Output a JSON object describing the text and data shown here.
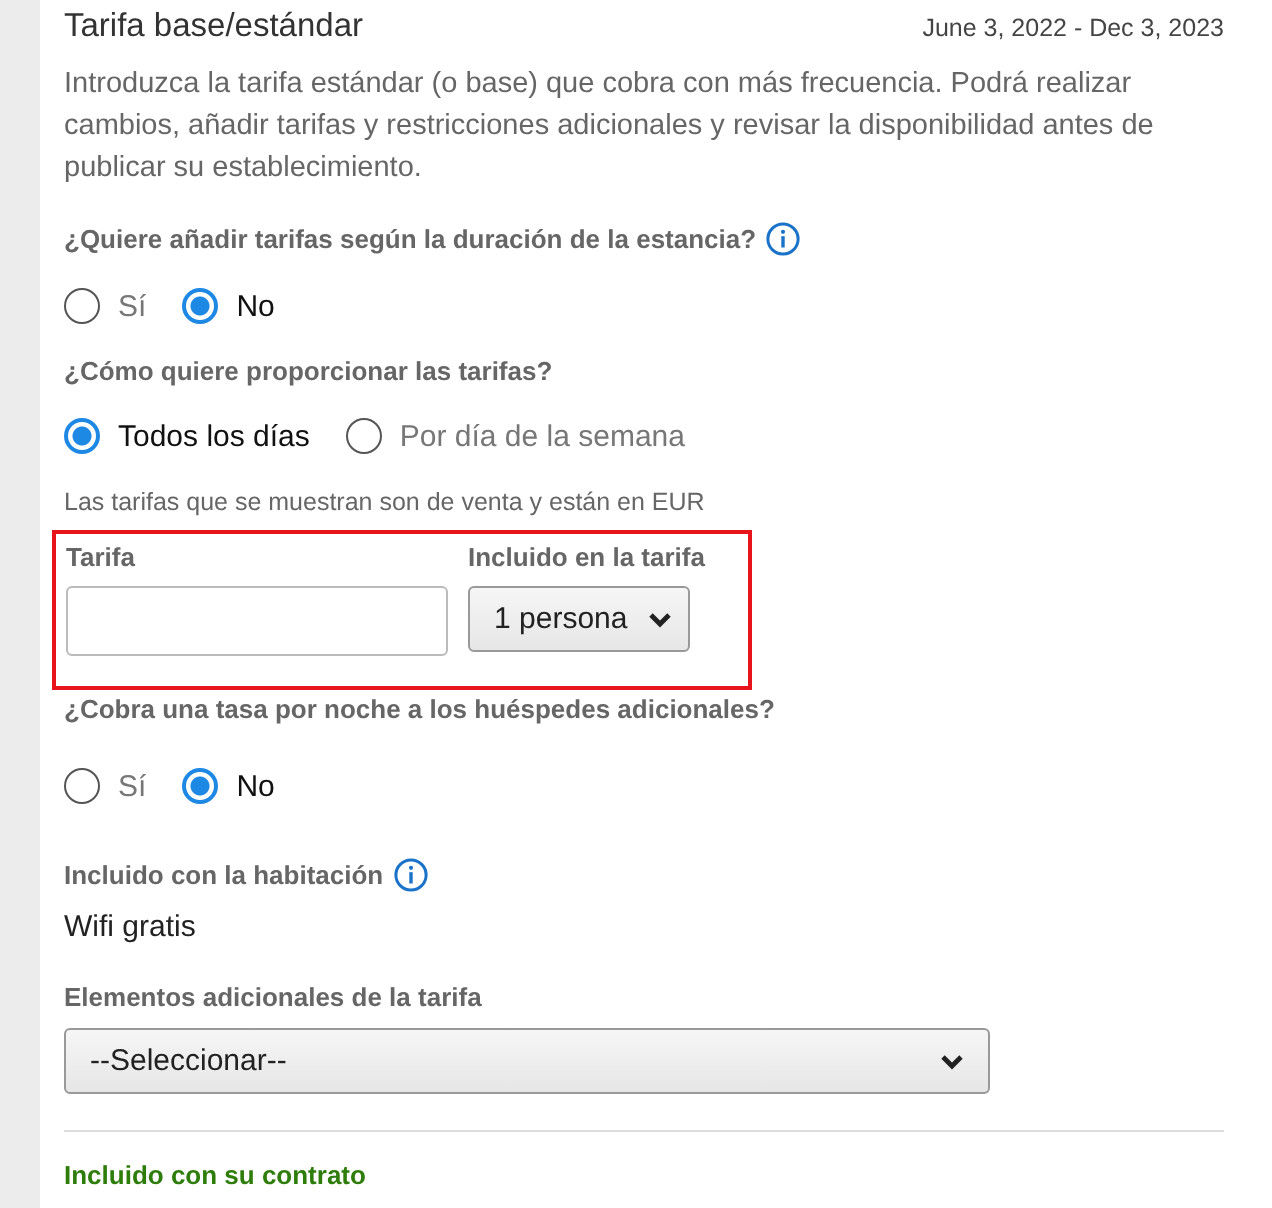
{
  "header": {
    "title": "Tarifa base/estándar",
    "dates": "June 3, 2022 - Dec 3, 2023"
  },
  "description": "Introduzca la tarifa estándar (o base) que cobra con más frecuencia. Podrá realizar cambios, añadir tarifas y restricciones adicionales y revisar la disponibilidad antes de publicar su establecimiento.",
  "q_length": {
    "label": "¿Quiere añadir tarifas según la duración de la estancia?",
    "info": true,
    "options": [
      {
        "label": "Sí",
        "selected": false
      },
      {
        "label": "No",
        "selected": true
      }
    ]
  },
  "q_provide": {
    "label": "¿Cómo quiere proporcionar las tarifas?",
    "info": false,
    "options": [
      {
        "label": "Todos los días",
        "selected": true
      },
      {
        "label": "Por día de la semana",
        "selected": false
      }
    ]
  },
  "currency_note": "Las tarifas que se muestran son de venta y están en EUR",
  "rate_fields": {
    "highlighted": true,
    "rate_label": "Tarifa",
    "included_label": "Incluido en la tarifa",
    "included_value": "1 persona"
  },
  "q_extra": {
    "label": "¿Cobra una tasa por noche a los huéspedes adicionales?",
    "info": false,
    "options": [
      {
        "label": "Sí",
        "selected": false
      },
      {
        "label": "No",
        "selected": true
      }
    ]
  },
  "included_room": {
    "label": "Incluido con la habitación",
    "info": true,
    "value": "Wifi gratis"
  },
  "extras": {
    "label": "Elementos adicionales de la tarifa",
    "value": "--Seleccionar--"
  },
  "contract_heading": "Incluido con su contrato"
}
